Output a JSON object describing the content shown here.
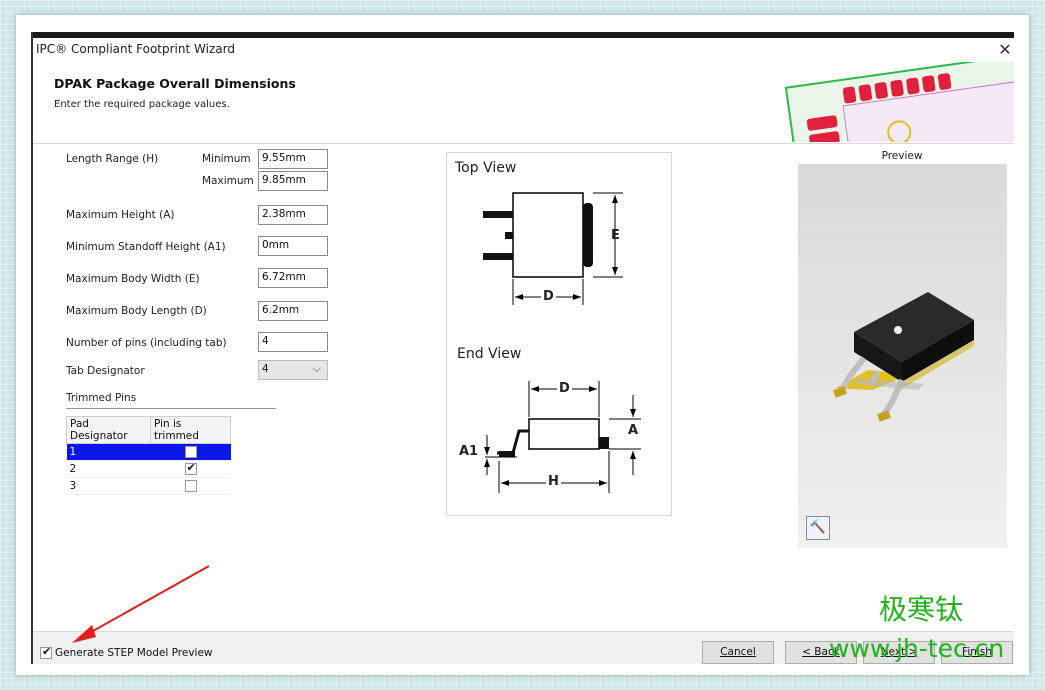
{
  "window": {
    "title": "IPC® Compliant Footprint Wizard",
    "close_glyph": "✕"
  },
  "header": {
    "title": "DPAK Package Overall Dimensions",
    "subtitle": "Enter the required package values."
  },
  "form": {
    "length_range_label": "Length Range (H)",
    "minimum_label": "Minimum",
    "minimum_value": "9.55mm",
    "maximum_label": "Maximum",
    "maximum_value": "9.85mm",
    "max_height_label": "Maximum Height (A)",
    "max_height_value": "2.38mm",
    "min_standoff_label": "Minimum Standoff Height (A1)",
    "min_standoff_value": "0mm",
    "max_body_width_label": "Maximum Body Width (E)",
    "max_body_width_value": "6.72mm",
    "max_body_length_label": "Maximum Body Length (D)",
    "max_body_length_value": "6.2mm",
    "num_pins_label": "Number of pins (including tab)",
    "num_pins_value": "4",
    "tab_designator_label": "Tab Designator",
    "tab_designator_value": "4"
  },
  "trimmed": {
    "heading": "Trimmed Pins",
    "columns": [
      "Pad Designator",
      "Pin is trimmed"
    ],
    "rows": [
      {
        "pad": "1",
        "trimmed": false,
        "selected": true
      },
      {
        "pad": "2",
        "trimmed": true,
        "selected": false
      },
      {
        "pad": "3",
        "trimmed": false,
        "selected": false
      }
    ]
  },
  "diagram": {
    "top_view_title": "Top View",
    "end_view_title": "End View",
    "labels": {
      "E": "E",
      "D": "D",
      "A": "A",
      "A1": "A1",
      "H": "H"
    }
  },
  "preview": {
    "label": "Preview",
    "hammer_icon": "hammer-icon"
  },
  "footer": {
    "generate_step_label": "Generate STEP Model Preview",
    "generate_step_checked": true,
    "cancel": "Cancel",
    "back": "< Back",
    "next": "Next >",
    "finish": "Finish"
  },
  "watermark": {
    "line1": "极寒钛",
    "line2": "www.jh-tec.cn"
  },
  "colors": {
    "selection": "#0a17e8",
    "annotation_arrow": "#e0201c",
    "watermark": "#22b21c",
    "pcb_pad": "#e0203c"
  }
}
